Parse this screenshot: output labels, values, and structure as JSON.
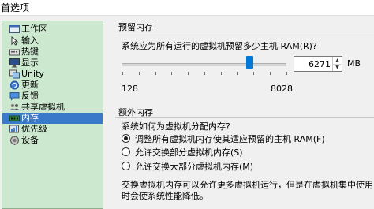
{
  "window": {
    "title": "首选项"
  },
  "sidebar": {
    "items": [
      {
        "label": "工作区",
        "icon": "workspace-icon",
        "selected": false
      },
      {
        "label": "输入",
        "icon": "input-icon",
        "selected": false
      },
      {
        "label": "热键",
        "icon": "hotkey-icon",
        "selected": false
      },
      {
        "label": "显示",
        "icon": "display-icon",
        "selected": false
      },
      {
        "label": "Unity",
        "icon": "unity-icon",
        "selected": false
      },
      {
        "label": "更新",
        "icon": "update-icon",
        "selected": false
      },
      {
        "label": "反馈",
        "icon": "feedback-icon",
        "selected": false
      },
      {
        "label": "共享虚拟机",
        "icon": "shared-vm-icon",
        "selected": false
      },
      {
        "label": "内存",
        "icon": "memory-icon",
        "selected": true
      },
      {
        "label": "优先级",
        "icon": "priority-icon",
        "selected": false
      },
      {
        "label": "设备",
        "icon": "devices-icon",
        "selected": false
      }
    ]
  },
  "reserved_memory": {
    "title": "预留内存",
    "question": "系统应为所有运行的虚拟机预留多少主机 RAM(R)?",
    "min_label": "128",
    "max_label": "8028",
    "slider_min": 128,
    "slider_max": 8028,
    "value": 6271,
    "value_text": "6271",
    "unit": "MB"
  },
  "additional_memory": {
    "title": "额外内存",
    "question": "系统如何为虚拟机分配内存?",
    "options": [
      {
        "label": "调整所有虚拟机内存使其适应预留的主机 RAM(F)",
        "checked": true
      },
      {
        "label": "允许交换部分虚拟机内存(S)",
        "checked": false
      },
      {
        "label": "允许交换大部分虚拟机内存(M)",
        "checked": false
      }
    ],
    "note_line1": "交换虚拟机内存可以允许更多虚拟机运行，但是在虚拟机集中使用内存",
    "note_line2": "时会使系统性能降低。"
  },
  "colors": {
    "sidebar_bg": "#cce8cf",
    "selection": "#3a78c9",
    "slider_thumb": "#0078d7"
  }
}
